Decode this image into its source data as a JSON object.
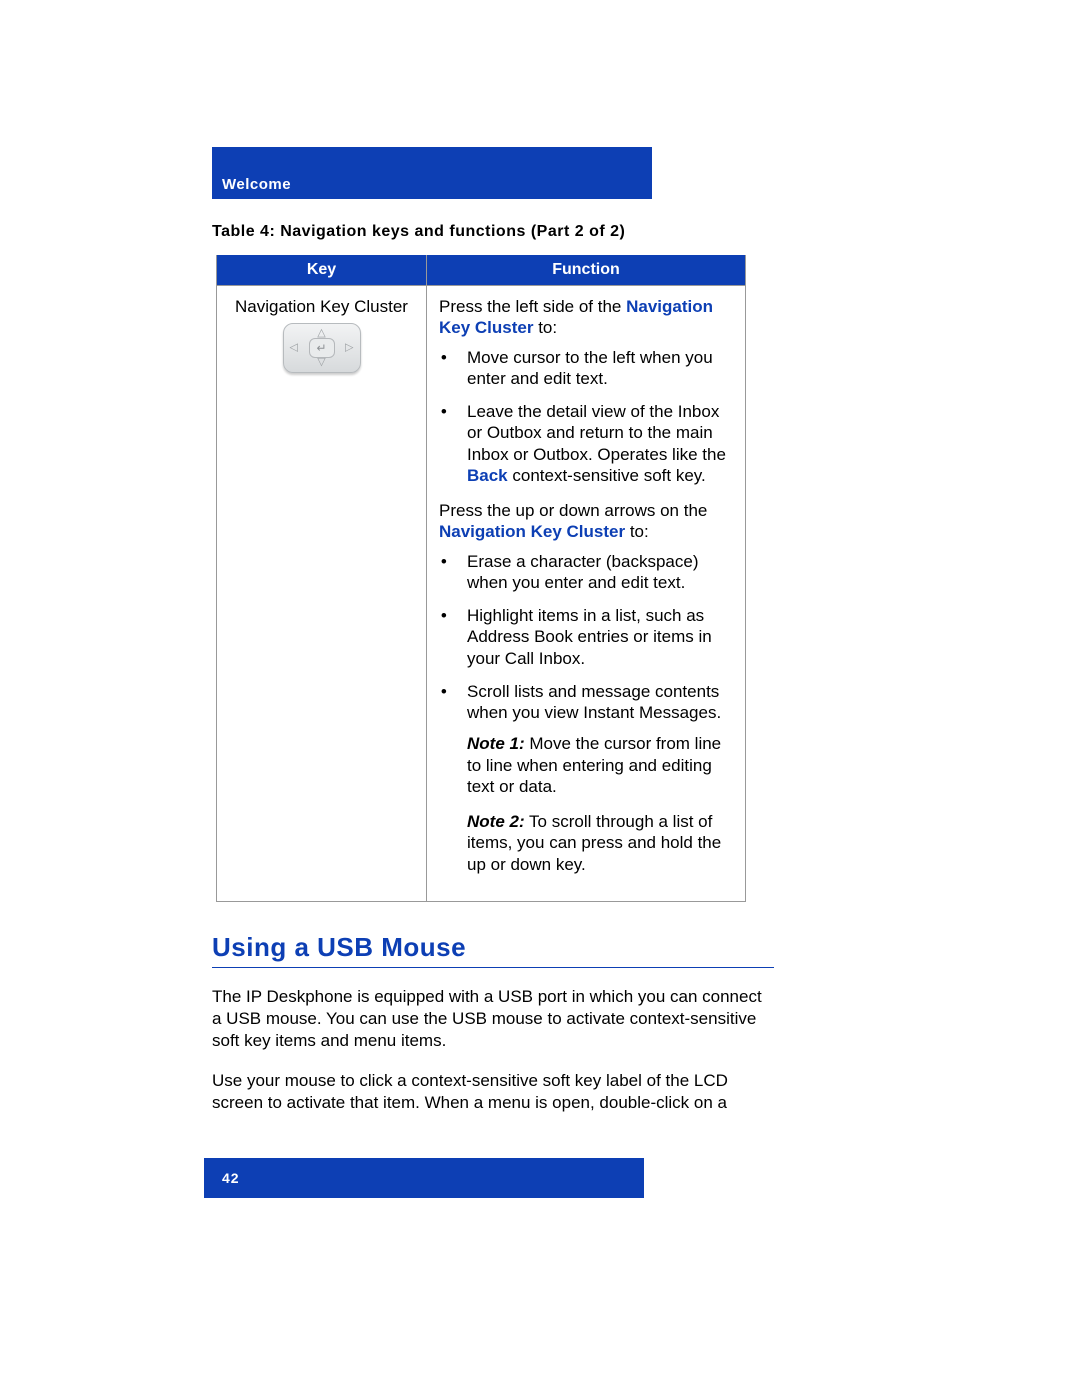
{
  "header": {
    "section": "Welcome"
  },
  "table": {
    "caption": "Table 4: Navigation keys and functions (Part 2 of 2)",
    "headers": {
      "key": "Key",
      "function": "Function"
    },
    "key_label": "Navigation Key Cluster",
    "fn": {
      "press_left_pre": "Press the left side of the ",
      "nav_key_cluster": "Navigation Key Cluster",
      "to_colon": " to:",
      "left_items": [
        "Move cursor to the left when you enter and edit text.",
        "Leave the detail view of the Inbox or Outbox and return to the main Inbox or Outbox. Operates like the "
      ],
      "back_label": "Back",
      "back_suffix": " context-sensitive soft key.",
      "press_updown_pre": "Press the up or down arrows on the ",
      "updown_items": [
        "Erase a character (backspace) when you enter and edit text.",
        "Highlight items in a list, such as Address Book entries or items in your Call Inbox.",
        "Scroll lists and message contents when you view Instant Messages."
      ],
      "note1_label": "Note 1:",
      "note1_text": " Move the cursor from line to line when entering and editing text or data.",
      "note2_label": "Note 2:",
      "note2_text": "  To scroll through a list of items, you can press and hold the up or down key."
    }
  },
  "section": {
    "heading": "Using a USB Mouse",
    "p1": "The IP Deskphone is equipped with a USB port in which you can connect a USB mouse. You can use the USB mouse to activate context-sensitive soft key items and menu items.",
    "p2": "Use your mouse to click a context-sensitive soft key label of the LCD screen to activate that item. When a menu is open, double-click on a"
  },
  "footer": {
    "page_number": "42"
  }
}
